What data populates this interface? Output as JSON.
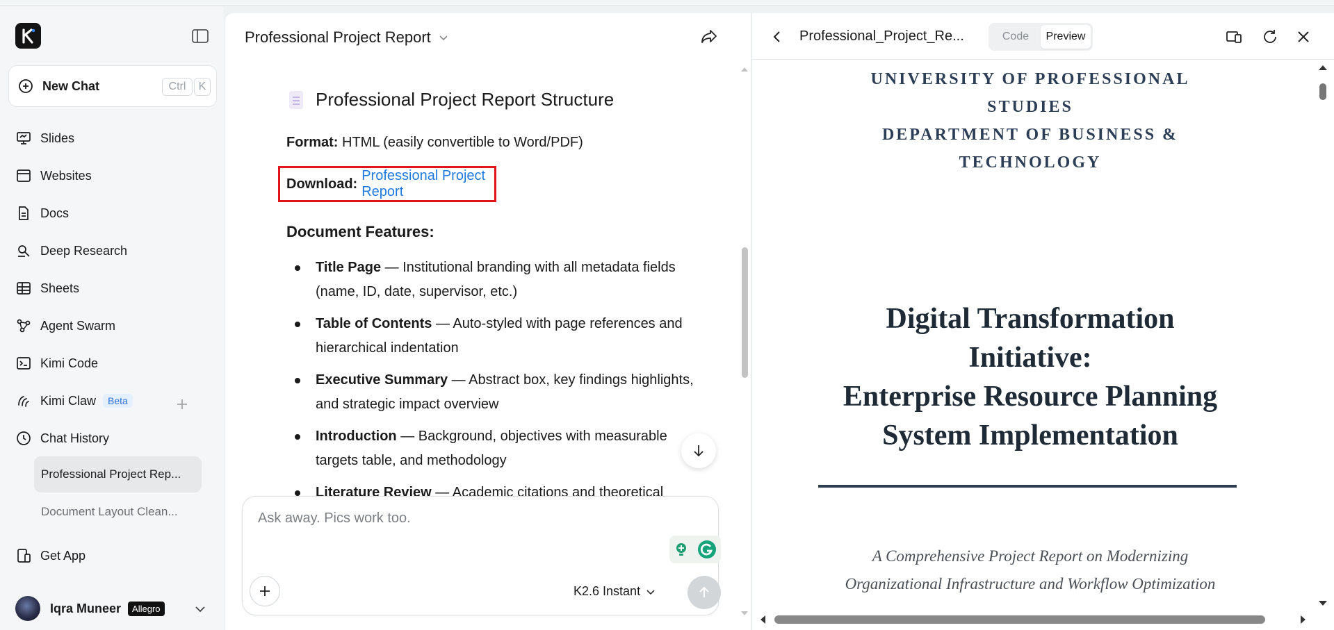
{
  "sidebar": {
    "logo_letter": "K",
    "new_chat": {
      "label": "New Chat",
      "kbd_ctrl": "Ctrl",
      "kbd_k": "K"
    },
    "items": [
      {
        "label": "Slides"
      },
      {
        "label": "Websites"
      },
      {
        "label": "Docs"
      },
      {
        "label": "Deep Research"
      },
      {
        "label": "Sheets"
      },
      {
        "label": "Agent Swarm"
      },
      {
        "label": "Kimi Code"
      },
      {
        "label": "Kimi Claw",
        "badge": "Beta"
      },
      {
        "label": "Chat History"
      }
    ],
    "history": [
      {
        "label": "Professional Project Rep..."
      },
      {
        "label": "Document Layout Clean..."
      }
    ],
    "get_app": "Get App",
    "user": {
      "name": "Iqra Muneer",
      "plan": "Allegro"
    }
  },
  "chat": {
    "title": "Professional Project Report",
    "heading": "Professional Project Report Structure",
    "format_label": "Format:",
    "format_value": "HTML (easily convertible to Word/PDF)",
    "download_label": "Download:",
    "download_link": "Professional Project Report",
    "features_heading": "Document Features:",
    "features": [
      {
        "title": "Title Page",
        "text": " — Institutional branding with all metadata fields (name, ID, date, supervisor, etc.)"
      },
      {
        "title": "Table of Contents",
        "text": " — Auto-styled with page references and hierarchical indentation"
      },
      {
        "title": "Executive Summary",
        "text": " — Abstract box, key findings highlights, and strategic impact overview"
      },
      {
        "title": "Introduction",
        "text": " — Background, objectives with measurable targets table, and methodology"
      },
      {
        "title": "Literature Review",
        "text": " — Academic citations and theoretical"
      }
    ],
    "composer": {
      "placeholder": "Ask away. Pics work too.",
      "model": "K2.6 Instant"
    }
  },
  "preview": {
    "file_title": "Professional_Project_Re...",
    "tab_code": "Code",
    "tab_preview": "Preview",
    "document": {
      "uni_lines": [
        "UNIVERSITY OF PROFESSIONAL",
        "STUDIES",
        "DEPARTMENT OF BUSINESS &",
        "TECHNOLOGY"
      ],
      "title_lines": [
        "Digital Transformation",
        "Initiative:",
        "Enterprise Resource Planning",
        "System Implementation"
      ],
      "subtitle_lines": [
        "A Comprehensive Project Report on Modernizing",
        "Organizational Infrastructure and Workflow Optimization"
      ]
    }
  },
  "colors": {
    "accent_link": "#1f7ae0",
    "highlight_border": "#e0141a",
    "beta_text": "#2f6fde"
  }
}
